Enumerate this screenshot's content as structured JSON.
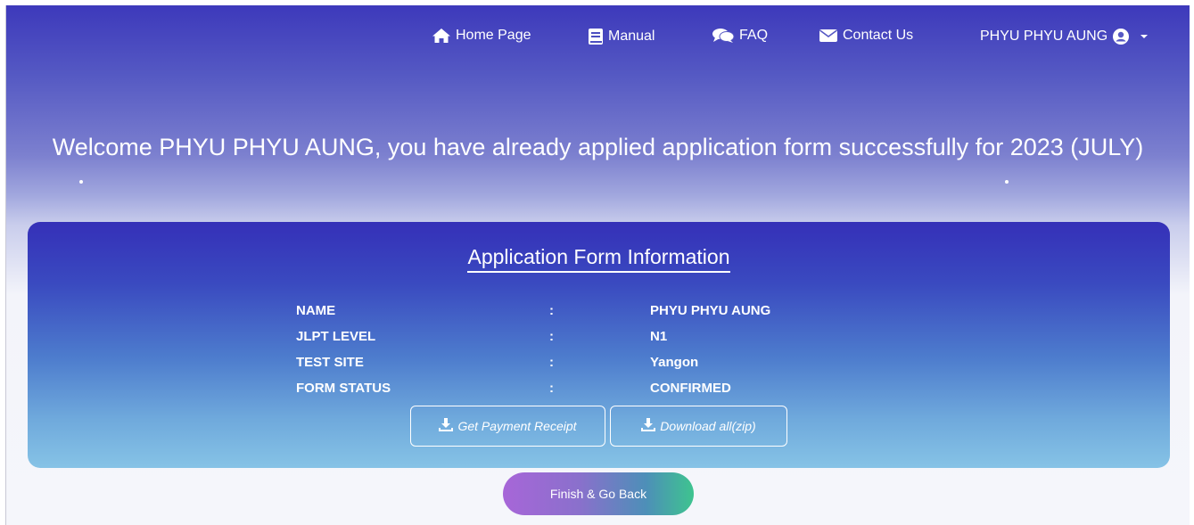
{
  "nav": {
    "home": {
      "label": "Home Page",
      "icon": "home-icon"
    },
    "manual": {
      "label": "Manual",
      "icon": "book-icon"
    },
    "faq": {
      "label": "FAQ",
      "icon": "comments-icon"
    },
    "contact": {
      "label": "Contact Us",
      "icon": "envelope-icon"
    },
    "user": {
      "label": "PHYU PHYU AUNG",
      "icon": "user-circle-icon"
    }
  },
  "welcome": {
    "text": "Welcome PHYU PHYU AUNG, you have already applied application form successfully for 2023 (JULY)"
  },
  "card": {
    "title": "Application Form Information",
    "rows": [
      {
        "label": "NAME",
        "colon": ":",
        "value": "PHYU PHYU AUNG"
      },
      {
        "label": "JLPT LEVEL",
        "colon": ":",
        "value": "N1"
      },
      {
        "label": "TEST SITE",
        "colon": ":",
        "value": "Yangon"
      },
      {
        "label": "FORM STATUS",
        "colon": ":",
        "value": "CONFIRMED"
      }
    ],
    "receipt_button": "Get Payment Receipt",
    "zip_button": "Download all(zip)"
  },
  "finish_button": "Finish & Go Back",
  "colors": {
    "hero_top": "#3d39bb",
    "card_top": "#3530b8",
    "card_bottom": "#86c3e6",
    "finish_start": "#a766d8",
    "finish_end": "#3ec48f"
  }
}
